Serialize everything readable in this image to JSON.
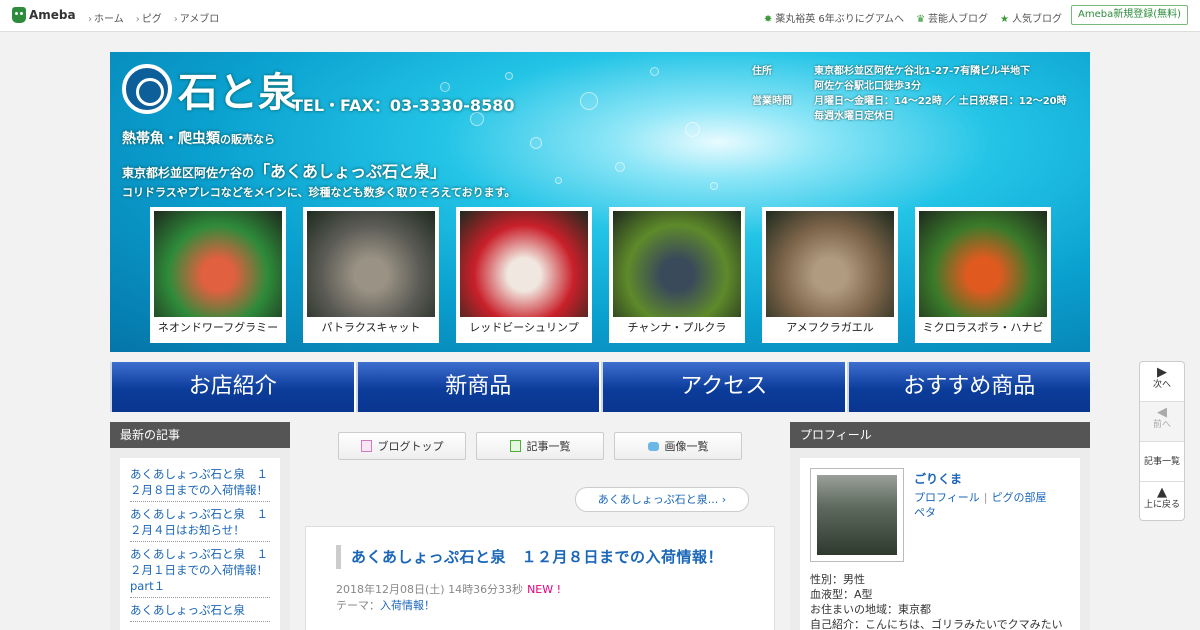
{
  "topbar": {
    "logo": "Ameba",
    "nav_left": [
      "ホーム",
      "ピグ",
      "アメブロ"
    ],
    "nav_right": [
      {
        "icon": "star-icon",
        "label": "薬丸裕英 6年ぶりにグアムへ"
      },
      {
        "icon": "crown-icon",
        "label": "芸能人ブログ"
      },
      {
        "icon": "star-icon",
        "label": "人気ブログ"
      }
    ],
    "signup": "Ameba新規登録(無料)"
  },
  "banner": {
    "shop_name": "石と泉",
    "tel": "TEL・FAX：03-3330-8580",
    "address_label": "住所",
    "address_1": "東京都杉並区阿佐ケ谷北1-27-7有隣ビル半地下",
    "address_2": "阿佐ケ谷駅北口徒歩3分",
    "hours_label": "営業時間",
    "hours_1": "月曜日～金曜日：14～22時 ／ 土日祝祭日：12～20時",
    "hours_2": "毎週水曜日定休日",
    "line1_main": "熱帯魚・爬虫類",
    "line1_suffix": "の販売なら",
    "line2_prefix": "東京都杉並区阿佐ケ谷の",
    "line2_main": "「あくあしょっぷ石と泉」",
    "line3": "コリドラスやプレコなどをメインに、珍種なども数多く取りそろえております。",
    "fish": [
      {
        "caption": "ネオンドワーフグラミー",
        "color_a": "#2e8b3a",
        "color_b": "#e06040"
      },
      {
        "caption": "パトラクスキャット",
        "color_a": "#5b5b55",
        "color_b": "#9a9284"
      },
      {
        "caption": "レッドビーシュリンプ",
        "color_a": "#c9202a",
        "color_b": "#f0e8e0"
      },
      {
        "caption": "チャンナ・プルクラ",
        "color_a": "#5e8a2a",
        "color_b": "#3a4a5a"
      },
      {
        "caption": "アメフクラガエル",
        "color_a": "#7a6248",
        "color_b": "#b09a80"
      },
      {
        "caption": "ミクロラスボラ・ハナビ",
        "color_a": "#3a7a2a",
        "color_b": "#e05a20"
      }
    ]
  },
  "menu": [
    "お店紹介",
    "新商品",
    "アクセス",
    "おすすめ商品"
  ],
  "left": {
    "heading": "最新の記事",
    "items": [
      "あくあしょっぷ石と泉　１２月８日までの入荷情報！",
      "あくあしょっぷ石と泉　１２月４日はお知らせ！",
      "あくあしょっぷ石と泉　１２月１日までの入荷情報！　part１",
      "あくあしょっぷ石と泉"
    ]
  },
  "center": {
    "buttons": [
      {
        "icon": "document-icon",
        "label": "ブログトップ"
      },
      {
        "icon": "list-icon",
        "label": "記事一覧"
      },
      {
        "icon": "camera-icon",
        "label": "画像一覧"
      }
    ],
    "prev_link": "あくあしょっぷ石と泉...",
    "article": {
      "title": "あくあしょっぷ石と泉　１２月８日までの入荷情報！",
      "date": "2018年12月08日(土) 14時36分33秒",
      "new_badge": "NEW !",
      "theme_label": "テーマ：",
      "theme": "入荷情報！"
    }
  },
  "right": {
    "heading": "プロフィール",
    "name": "ごりくま",
    "link_profile": "プロフィール",
    "link_pig": "ピグの部屋",
    "link_peta": "ペタ",
    "gender": "性別：男性",
    "blood": "血液型：A型",
    "area": "お住まいの地域：東京都",
    "intro": "自己紹介：こんにちは、ゴリラみたいでクマみたい"
  },
  "sidenav": {
    "next": "次へ",
    "prev": "前へ",
    "list": "記事一覧",
    "top": "上に戻る"
  }
}
